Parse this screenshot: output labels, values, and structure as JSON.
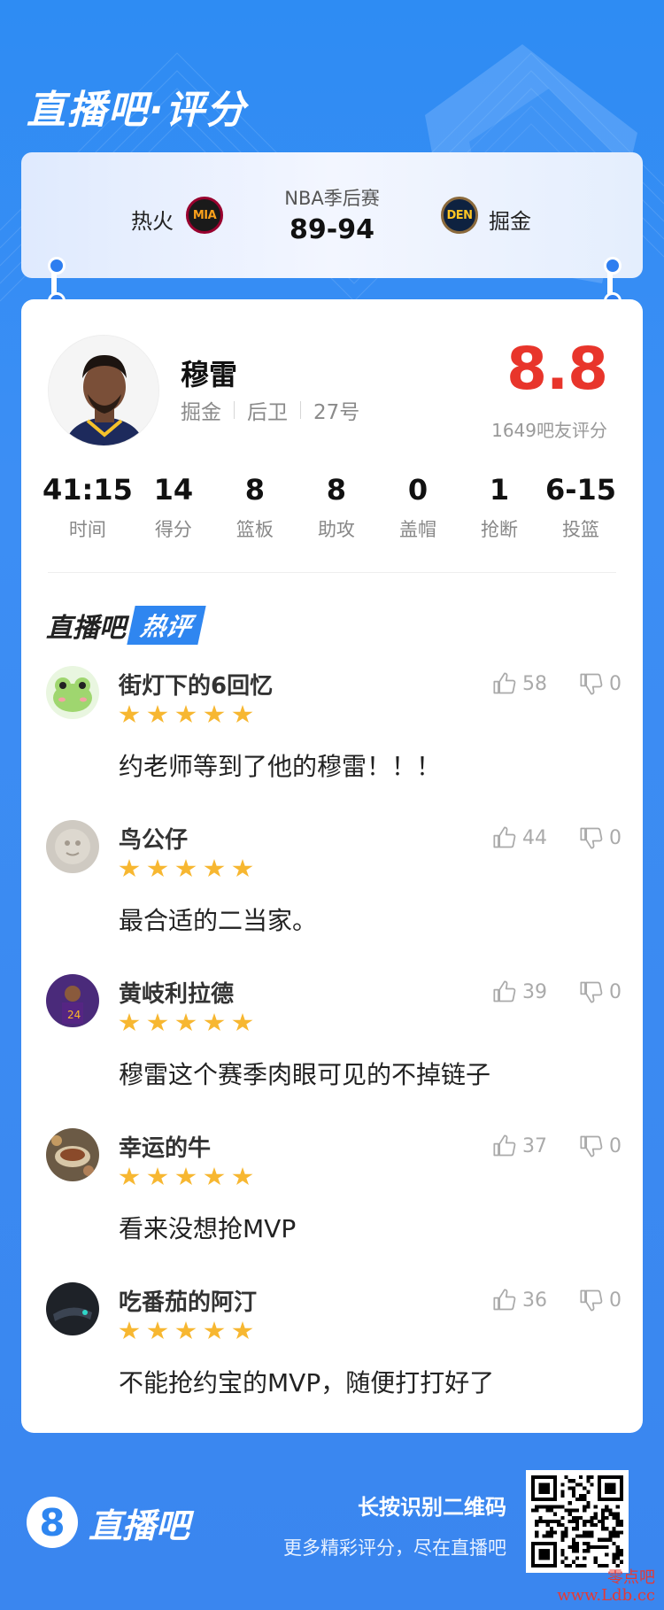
{
  "app": {
    "title": "直播吧·评分"
  },
  "match": {
    "home_team": "热火",
    "home_logo": "MIA",
    "league": "NBA季后赛",
    "score": "89-94",
    "away_team": "掘金",
    "away_logo": "DEN"
  },
  "player": {
    "name": "穆雷",
    "team": "掘金",
    "position": "后卫",
    "number": "27号",
    "rating": "8.8",
    "rating_count": "1649吧友评分"
  },
  "stats": [
    {
      "value": "41:15",
      "label": "时间"
    },
    {
      "value": "14",
      "label": "得分"
    },
    {
      "value": "8",
      "label": "篮板"
    },
    {
      "value": "8",
      "label": "助攻"
    },
    {
      "value": "0",
      "label": "盖帽"
    },
    {
      "value": "1",
      "label": "抢断"
    },
    {
      "value": "6-15",
      "label": "投篮"
    }
  ],
  "hot_comments": {
    "title_prefix": "直播吧",
    "title_tag": "热评",
    "items": [
      {
        "user": "街灯下的6回忆",
        "stars": 5,
        "text": "约老师等到了他的穆雷！！！",
        "likes": "58",
        "dislikes": "0"
      },
      {
        "user": "鸟公仔",
        "stars": 5,
        "text": "最合适的二当家。",
        "likes": "44",
        "dislikes": "0"
      },
      {
        "user": "黄岐利拉德",
        "stars": 5,
        "text": "穆雷这个赛季肉眼可见的不掉链子",
        "likes": "39",
        "dislikes": "0"
      },
      {
        "user": "幸运的牛",
        "stars": 5,
        "text": "看来没想抢MVP",
        "likes": "37",
        "dislikes": "0"
      },
      {
        "user": "吃番茄的阿汀",
        "stars": 5,
        "text": "不能抢约宝的MVP，随便打打好了",
        "likes": "36",
        "dislikes": "0"
      }
    ]
  },
  "footer": {
    "logo_mark": "8",
    "logo_text": "直播吧",
    "line1": "长按识别二维码",
    "line2": "更多精彩评分，尽在直播吧"
  },
  "watermark": {
    "line1": "零点吧",
    "line2": "www.Ldb.cc"
  },
  "colors": {
    "primary": "#2e86f0",
    "rating": "#e8352b",
    "star": "#f7b731"
  }
}
